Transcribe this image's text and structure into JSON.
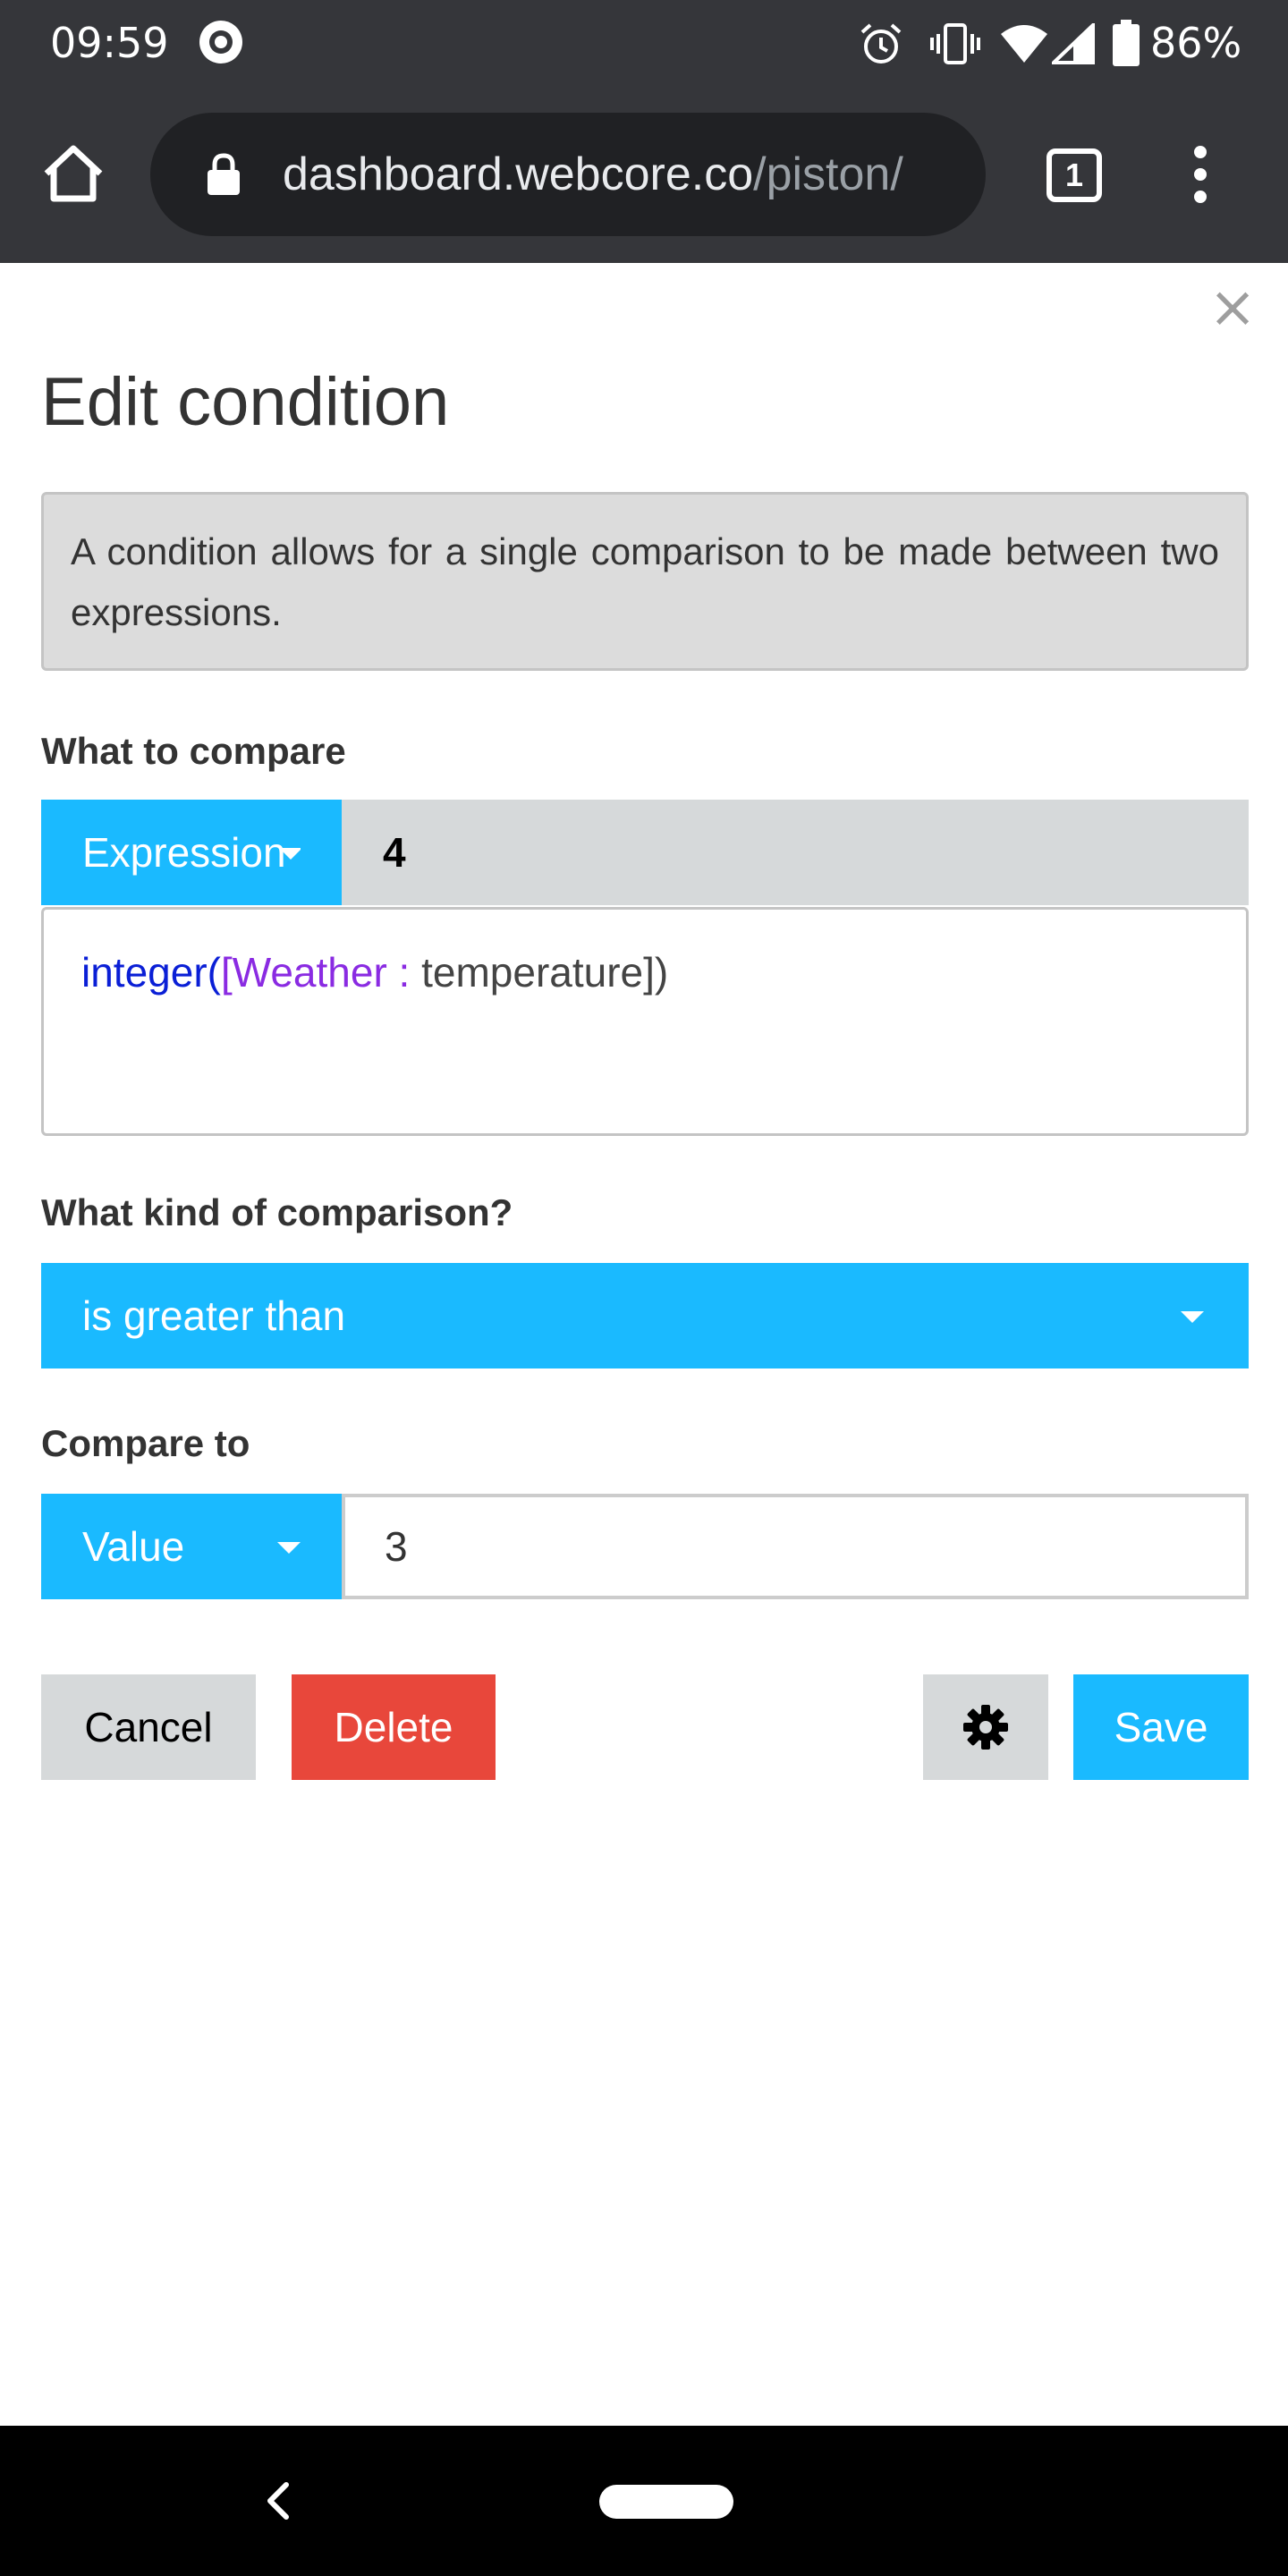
{
  "status_bar": {
    "time": "09:59",
    "battery_percent": "86%"
  },
  "browser": {
    "url_domain": "dashboard.webcore.co",
    "url_path": "/piston/",
    "tab_count": "1"
  },
  "dialog": {
    "title": "Edit condition",
    "close_label": "×",
    "description": "A condition allows for a single comparison to be made between two expressions.",
    "what_to_compare": {
      "label": "What to compare",
      "operand_type": "Expression",
      "evaluated_value": "4",
      "expression": {
        "func_open": "integer(",
        "device_part": "[Weather : ",
        "attribute_part": "temperature",
        "close_part": "])"
      }
    },
    "comparison": {
      "label": "What kind of comparison?",
      "selected": "is greater than"
    },
    "compare_to": {
      "label": "Compare to",
      "operand_type": "Value",
      "value": "3"
    },
    "buttons": {
      "cancel": "Cancel",
      "delete": "Delete",
      "save": "Save"
    }
  },
  "colors": {
    "accent_blue": "#1abaff",
    "delete_red": "#e8473b",
    "neutral_button": "#d6d9da",
    "chrome_dark": "#35363a"
  }
}
